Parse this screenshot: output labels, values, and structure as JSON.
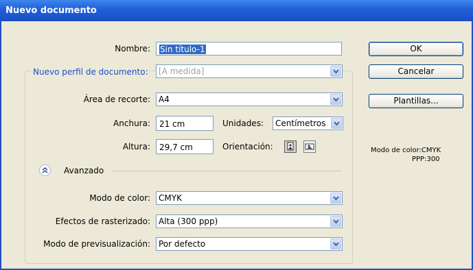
{
  "window": {
    "title": "Nuevo documento"
  },
  "form": {
    "name_label": "Nombre:",
    "name_value": "Sin título-1",
    "profile_label": "Nuevo perfil de documento:",
    "profile_value": "[A medida]",
    "artboard_label": "Área de recorte:",
    "artboard_value": "A4",
    "width_label": "Anchura:",
    "width_value": "21 cm",
    "units_label": "Unidades:",
    "units_value": "Centímetros",
    "height_label": "Altura:",
    "height_value": "29,7 cm",
    "orientation_label": "Orientación:",
    "advanced_label": "Avanzado",
    "color_mode_label": "Modo de color:",
    "color_mode_value": "CMYK",
    "raster_label": "Efectos de rasterizado:",
    "raster_value": "Alta (300 ppp)",
    "preview_label": "Modo de previsualización:",
    "preview_value": "Por defecto"
  },
  "buttons": {
    "ok": "OK",
    "cancel": "Cancelar",
    "templates": "Plantillas..."
  },
  "info": {
    "color_mode": "Modo de color:CMYK",
    "ppi": "PPP:300"
  },
  "colors": {
    "titlebar": "#1f5fd9",
    "dialog_bg": "#ece9d8",
    "accent_text": "#1f4fc8"
  },
  "icons": {
    "dropdown": "chevron-down-icon",
    "collapse": "double-chevron-up-icon",
    "portrait": "portrait-orientation-icon",
    "landscape": "landscape-orientation-icon"
  }
}
